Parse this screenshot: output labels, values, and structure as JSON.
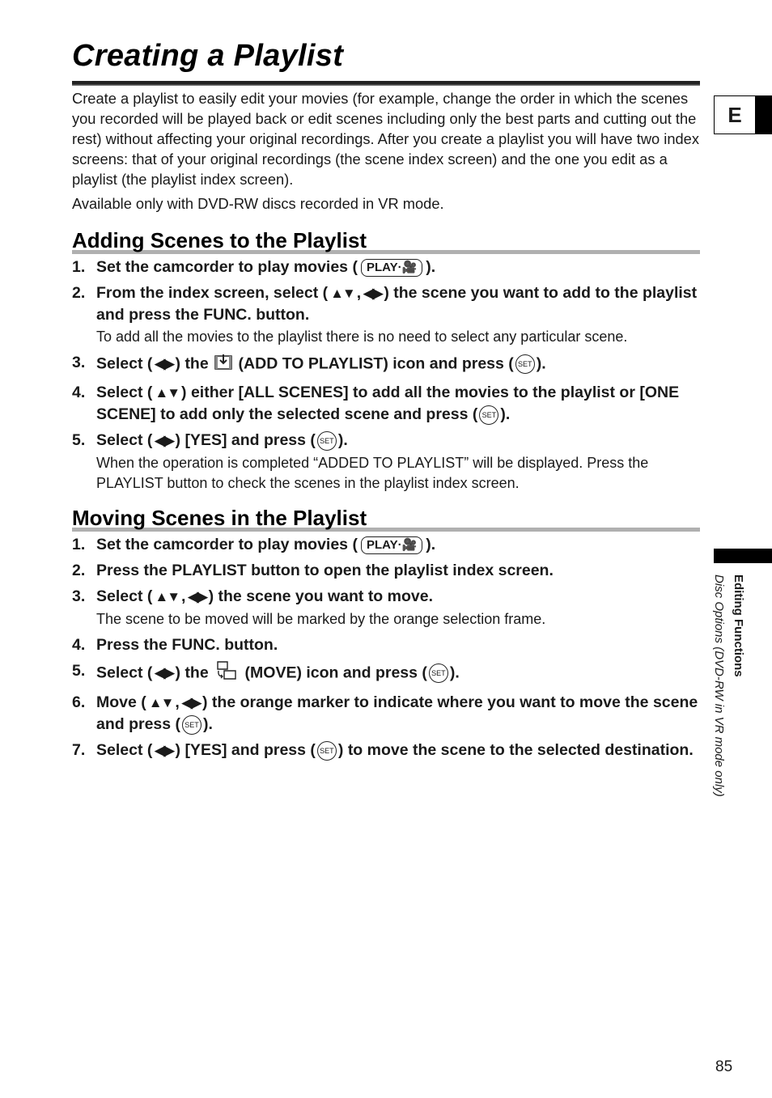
{
  "page": {
    "title": "Creating a Playlist",
    "intro": [
      "Create a playlist to easily edit your movies (for example, change the order in which the scenes you recorded will be played back or edit scenes including only the best parts and cutting out the rest) without affecting your original recordings. After you create a playlist you will have two index screens: that of your original recordings (the scene index screen) and the one you edit as a playlist (the playlist index screen).",
      "Available only with DVD-RW discs recorded in VR mode."
    ],
    "language_tab": "E",
    "side_label": {
      "section": "Editing Functions",
      "subsection": "Disc Options (DVD-RW in VR mode only)"
    },
    "page_number": "85"
  },
  "icons": {
    "play_mode": "PLAY·🎥",
    "set": "SET",
    "up_down": "▲▼",
    "left_right": "◀▶"
  },
  "sections": [
    {
      "heading": "Adding Scenes to the Playlist",
      "steps": [
        {
          "num": "1.",
          "parts": [
            "Set the camcorder to play movies (",
            ")."
          ],
          "note": ""
        },
        {
          "num": "2.",
          "parts": [
            "From the index screen, select (",
            ",",
            ") the scene you want to add to the playlist and press the FUNC. button."
          ],
          "note": "To add all the movies to the playlist there is no need to select any particular scene."
        },
        {
          "num": "3.",
          "parts": [
            "Select (",
            ") the",
            "(ADD TO PLAYLIST) icon and press (",
            ")."
          ],
          "note": ""
        },
        {
          "num": "4.",
          "parts": [
            "Select (",
            ") either [ALL SCENES] to add all the movies to the playlist or [ONE SCENE] to add only the selected scene and press (",
            ")."
          ],
          "note": ""
        },
        {
          "num": "5.",
          "parts": [
            "Select (",
            ") [YES] and press (",
            ")."
          ],
          "note": "When the operation is completed “ADDED TO PLAYLIST” will be displayed. Press the PLAYLIST button to check the scenes in the playlist index screen."
        }
      ]
    },
    {
      "heading": "Moving Scenes in the Playlist",
      "steps": [
        {
          "num": "1.",
          "parts": [
            "Set the camcorder to play movies (",
            ")."
          ],
          "note": ""
        },
        {
          "num": "2.",
          "parts": [
            "Press the PLAYLIST button to open the playlist index screen."
          ],
          "note": ""
        },
        {
          "num": "3.",
          "parts": [
            "Select (",
            ",",
            ") the scene you want to move."
          ],
          "note": "The scene to be moved will be marked by the orange selection frame."
        },
        {
          "num": "4.",
          "parts": [
            "Press the FUNC. button."
          ],
          "note": ""
        },
        {
          "num": "5.",
          "parts": [
            "Select (",
            ") the",
            "(MOVE) icon and press (",
            ")."
          ],
          "note": ""
        },
        {
          "num": "6.",
          "parts": [
            "Move (",
            ",",
            ") the orange marker to indicate where you want to move the scene and press (",
            ")."
          ],
          "note": ""
        },
        {
          "num": "7.",
          "parts": [
            "Select (",
            ") [YES] and press (",
            ") to move the scene to the selected destination."
          ],
          "note": ""
        }
      ]
    }
  ]
}
